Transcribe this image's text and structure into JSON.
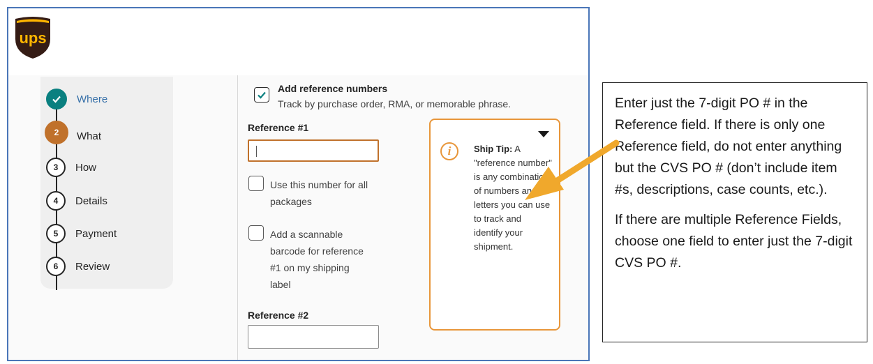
{
  "header": {
    "logo_icon": "ups-shield-logo",
    "logo_text": "ups"
  },
  "stepper": {
    "steps": [
      {
        "number": "",
        "label": "Where",
        "state": "done"
      },
      {
        "number": "2",
        "label": "What",
        "state": "current"
      },
      {
        "number": "3",
        "label": "How",
        "state": "todo"
      },
      {
        "number": "4",
        "label": "Details",
        "state": "todo"
      },
      {
        "number": "5",
        "label": "Payment",
        "state": "todo"
      },
      {
        "number": "6",
        "label": "Review",
        "state": "todo"
      }
    ]
  },
  "form": {
    "add_reference": {
      "label": "Add reference numbers",
      "description": "Track by purchase order, RMA, or memorable phrase.",
      "checked": true
    },
    "reference1": {
      "label": "Reference #1",
      "value": ""
    },
    "use_for_all": {
      "label_line1": "Use this number for all",
      "label_line2": "packages",
      "checked": false
    },
    "barcode": {
      "line1": "Add a scannable",
      "line2": "barcode for reference",
      "line3": "#1 on my shipping",
      "line4": "label",
      "checked": false
    },
    "reference2": {
      "label": "Reference #2",
      "value": ""
    }
  },
  "ship_tip": {
    "title": "Ship Tip:",
    "text": "A \"reference number\" is any combination of numbers and letters you can use to track and identify your shipment."
  },
  "callout": {
    "paragraph1": "Enter just the 7-digit PO # in the Reference field. If there is only one Reference field, do not enter anything but the CVS PO # (don’t include item #s, descriptions, case counts, etc.).",
    "paragraph2": "If there are multiple Reference Fields, choose one field to enter just the 7-digit CVS PO #."
  },
  "colors": {
    "ups_brown": "#351c15",
    "ups_gold": "#ffb500",
    "done_teal": "#0a8080",
    "current_orange": "#c0712b",
    "tip_orange": "#e8963a",
    "arrow": "#f0a82c",
    "frame_blue": "#4a76b8"
  }
}
